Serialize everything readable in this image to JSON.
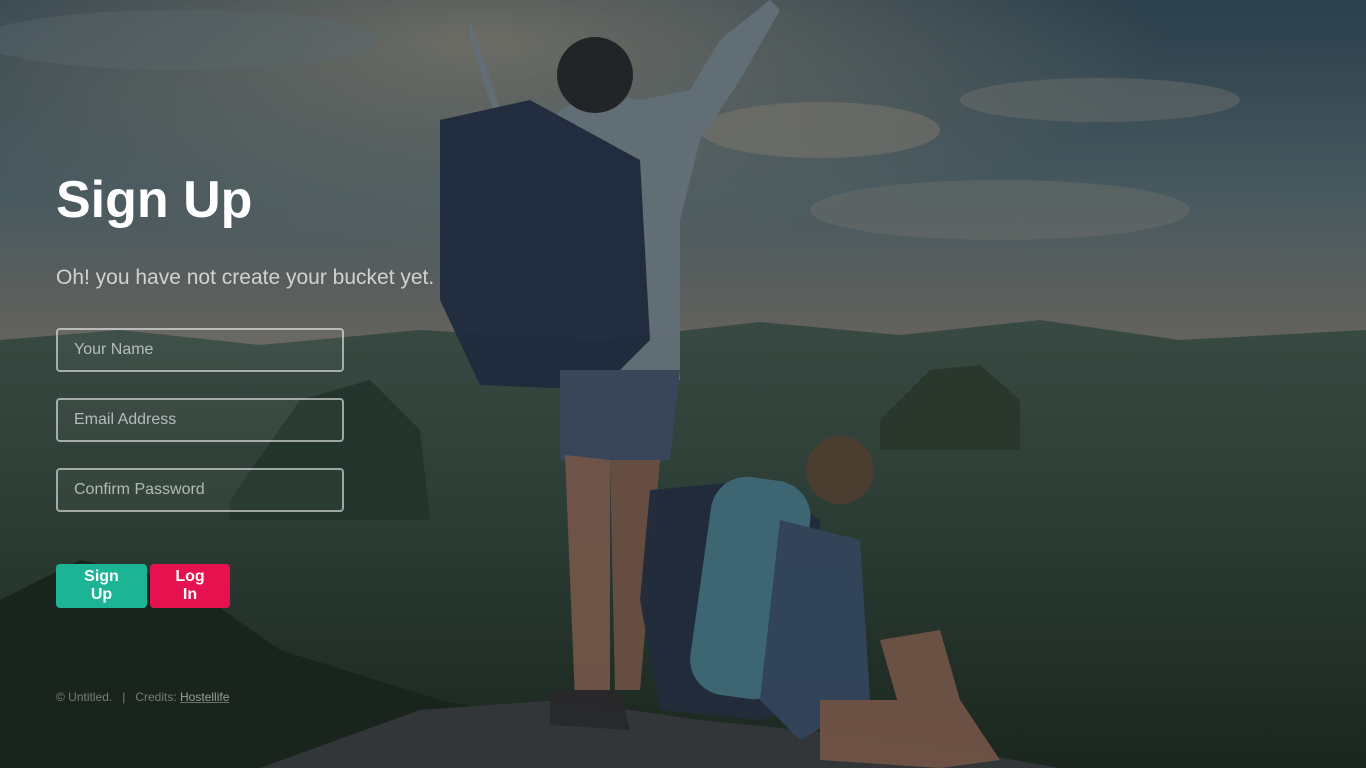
{
  "theme": {
    "signup_color": "#1cb495",
    "login_color": "#e6124f"
  },
  "hero": {
    "title": "Sign Up",
    "subtitle": "Oh! you have not create your bucket yet."
  },
  "form": {
    "name_placeholder": "Your Name",
    "email_placeholder": "Email Address",
    "password_placeholder": "Confirm Password",
    "signup_label": "Sign Up",
    "login_label": "Log In"
  },
  "footer": {
    "copyright": "© Untitled.",
    "separator": "|",
    "credits_label": "Credits:",
    "credits_link": "Hostellife"
  }
}
